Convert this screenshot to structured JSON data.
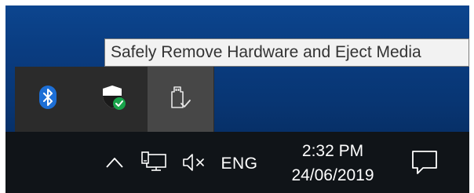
{
  "tooltip": {
    "text": "Safely Remove Hardware and Eject Media"
  },
  "tray_overflow": {
    "items": [
      {
        "icon": "bluetooth-icon"
      },
      {
        "icon": "windows-security-icon"
      },
      {
        "icon": "usb-drive-eject-icon"
      }
    ]
  },
  "taskbar": {
    "language": "ENG",
    "time": "2:32 PM",
    "date": "24/06/2019",
    "icons": [
      "chevron-up-icon",
      "network-icon",
      "volume-muted-icon",
      "action-center-icon"
    ]
  },
  "colors": {
    "desktop": "#0a3c80",
    "taskbar": "#101418",
    "flyout": "#2b2b2b",
    "flyout_hover": "#474747",
    "bluetooth": "#1d6fd6",
    "security_check": "#18a34a"
  }
}
